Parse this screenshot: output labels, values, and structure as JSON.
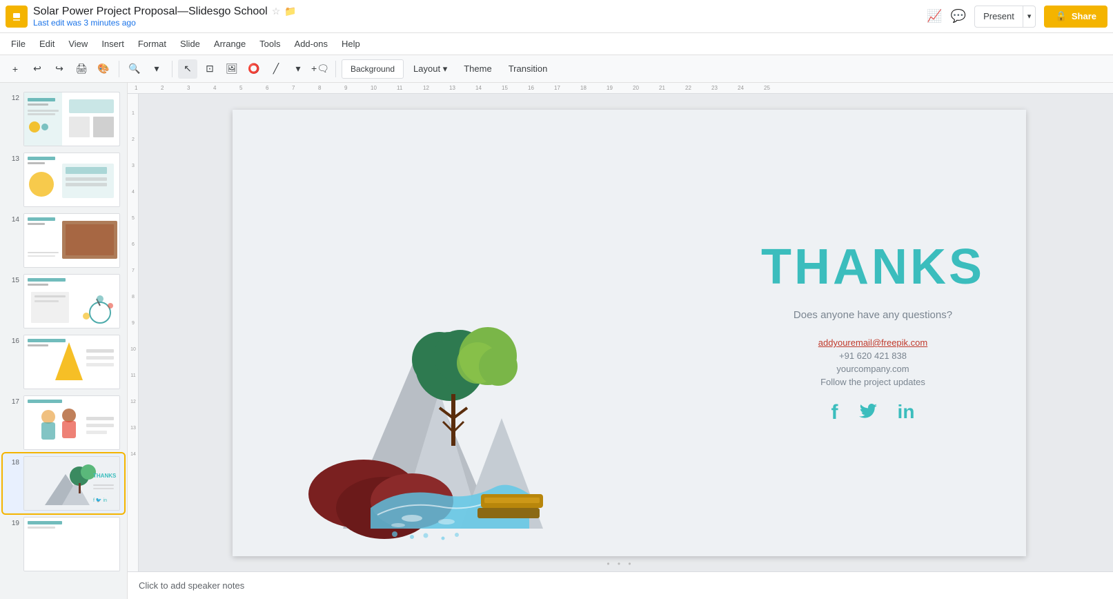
{
  "app": {
    "icon": "S",
    "title": "Solar Power Project Proposal—Slidesgo School",
    "star_icon": "☆",
    "folder_icon": "📁",
    "last_edit": "Last edit was 3 minutes ago"
  },
  "top_right": {
    "present_label": "Present",
    "share_label": "Share",
    "share_icon": "🔒"
  },
  "menu": {
    "items": [
      "File",
      "Edit",
      "View",
      "Insert",
      "Format",
      "Slide",
      "Arrange",
      "Tools",
      "Add-ons",
      "Help"
    ]
  },
  "toolbar": {
    "background_label": "Background",
    "layout_label": "Layout",
    "theme_label": "Theme",
    "transition_label": "Transition"
  },
  "slide": {
    "thanks_title": "THANKS",
    "question": "Does anyone have any questions?",
    "email": "addyouremail@freepik.com",
    "phone": "+91 620 421 838",
    "website": "yourcompany.com",
    "follow": "Follow the project updates",
    "social": [
      "f",
      "🐦",
      "in"
    ]
  },
  "sidebar": {
    "slides": [
      {
        "num": "12",
        "class": "thumb-12"
      },
      {
        "num": "13",
        "class": "thumb-13"
      },
      {
        "num": "14",
        "class": "thumb-14"
      },
      {
        "num": "15",
        "class": "thumb-15"
      },
      {
        "num": "16",
        "class": "thumb-16"
      },
      {
        "num": "17",
        "class": "thumb-17"
      },
      {
        "num": "18",
        "class": "thumb-18",
        "active": true
      },
      {
        "num": "19",
        "class": "thumb-13"
      }
    ]
  },
  "notes": {
    "placeholder": "Click to add speaker notes"
  },
  "ruler": {
    "marks": [
      "1",
      "2",
      "3",
      "4",
      "5",
      "6",
      "7",
      "8",
      "9",
      "10",
      "11",
      "12",
      "13",
      "14",
      "15",
      "16",
      "17",
      "18",
      "19",
      "20",
      "21",
      "22",
      "23",
      "24",
      "25"
    ]
  }
}
